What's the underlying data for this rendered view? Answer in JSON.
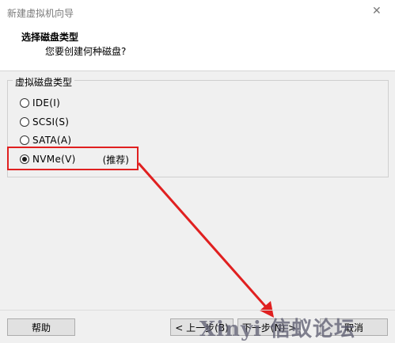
{
  "window": {
    "title": "新建虚拟机向导",
    "close_glyph": "✕"
  },
  "header": {
    "title": "选择磁盘类型",
    "subtitle": "您要创建何种磁盘?"
  },
  "group": {
    "legend": "虚拟磁盘类型",
    "options": [
      {
        "label": "IDE(I)",
        "selected": false
      },
      {
        "label": "SCSI(S)",
        "selected": false
      },
      {
        "label": "SATA(A)",
        "selected": false
      },
      {
        "label": "NVMe(V)",
        "selected": true,
        "note": "(推荐)"
      }
    ]
  },
  "footer": {
    "help": "帮助",
    "back": "< 上一步(B)",
    "next": "下一步(N) >",
    "cancel": "取消"
  },
  "watermark": "Xinyi 信蚁论坛",
  "annotation": {
    "color": "#e02020"
  }
}
